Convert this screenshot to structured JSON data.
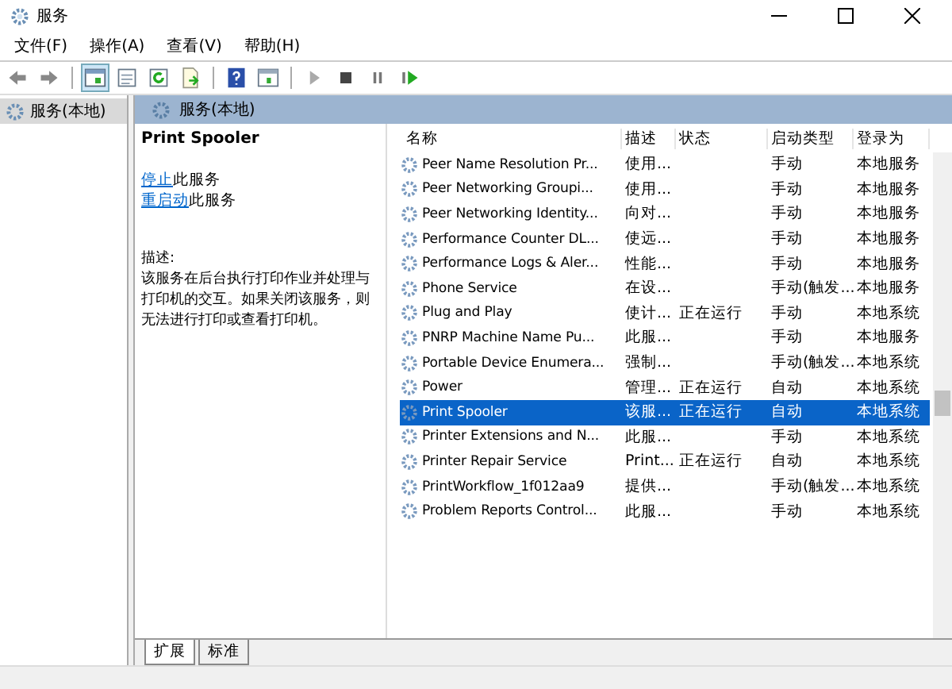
{
  "window": {
    "title": "服务"
  },
  "menu": [
    "文件(F)",
    "操作(A)",
    "查看(V)",
    "帮助(H)"
  ],
  "tree": [
    {
      "label": "服务(本地)",
      "selected": true
    }
  ],
  "panel_header": "服务(本地)",
  "details": {
    "name": "Print Spooler",
    "actions": [
      {
        "link": "停止",
        "text": "此服务"
      },
      {
        "link": "重启动",
        "text": "此服务"
      }
    ],
    "description_label": "描述:",
    "description": "该服务在后台执行打印作业并处理与打印机的交互。如果关闭该服务，则无法进行打印或查看打印机。"
  },
  "table": {
    "columns": [
      "名称",
      "描述",
      "状态",
      "启动类型",
      "登录为"
    ],
    "rows": [
      {
        "cells": [
          "Peer Name Resolution Pr...",
          "使用...",
          "",
          "手动",
          "本地服务"
        ],
        "selected": false
      },
      {
        "cells": [
          "Peer Networking Groupi...",
          "使用...",
          "",
          "手动",
          "本地服务"
        ],
        "selected": false
      },
      {
        "cells": [
          "Peer Networking Identity...",
          "向对...",
          "",
          "手动",
          "本地服务"
        ],
        "selected": false
      },
      {
        "cells": [
          "Performance Counter DL...",
          "使远...",
          "",
          "手动",
          "本地服务"
        ],
        "selected": false
      },
      {
        "cells": [
          "Performance Logs & Aler...",
          "性能...",
          "",
          "手动",
          "本地服务"
        ],
        "selected": false
      },
      {
        "cells": [
          "Phone Service",
          "在设...",
          "",
          "手动(触发...",
          "本地服务"
        ],
        "selected": false
      },
      {
        "cells": [
          "Plug and Play",
          "使计...",
          "正在运行",
          "手动",
          "本地系统"
        ],
        "selected": false
      },
      {
        "cells": [
          "PNRP Machine Name Pu...",
          "此服...",
          "",
          "手动",
          "本地服务"
        ],
        "selected": false
      },
      {
        "cells": [
          "Portable Device Enumera...",
          "强制...",
          "",
          "手动(触发...",
          "本地系统"
        ],
        "selected": false
      },
      {
        "cells": [
          "Power",
          "管理...",
          "正在运行",
          "自动",
          "本地系统"
        ],
        "selected": false
      },
      {
        "cells": [
          "Print Spooler",
          "该服...",
          "正在运行",
          "自动",
          "本地系统"
        ],
        "selected": true
      },
      {
        "cells": [
          "Printer Extensions and N...",
          "此服...",
          "",
          "手动",
          "本地系统"
        ],
        "selected": false
      },
      {
        "cells": [
          "Printer Repair Service",
          "Print...",
          "正在运行",
          "自动",
          "本地系统"
        ],
        "selected": false
      },
      {
        "cells": [
          "PrintWorkflow_1f012aa9",
          "提供...",
          "",
          "手动(触发...",
          "本地系统"
        ],
        "selected": false
      },
      {
        "cells": [
          "Problem Reports Control...",
          "此服...",
          "",
          "手动",
          "本地系统"
        ],
        "selected": false
      }
    ]
  },
  "tabs": [
    {
      "label": "扩展",
      "selected": true
    },
    {
      "label": "标准",
      "selected": false
    }
  ]
}
